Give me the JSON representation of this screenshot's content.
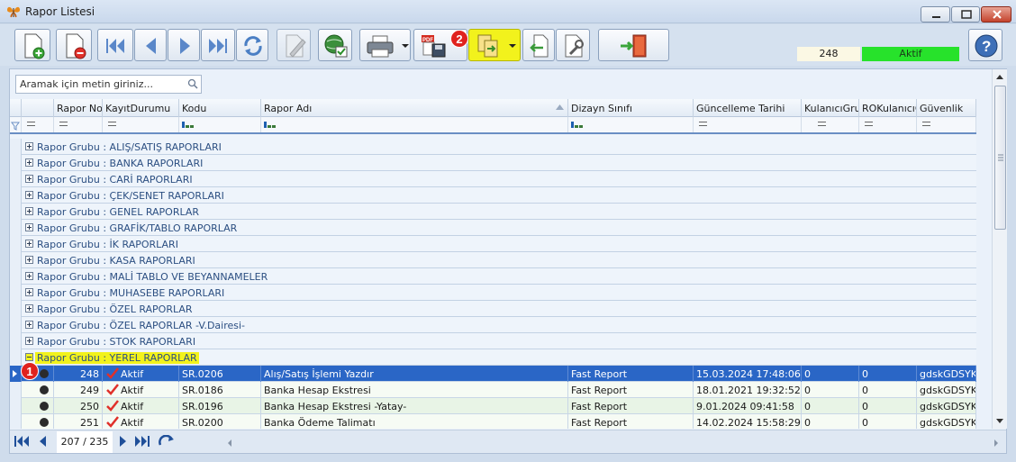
{
  "window": {
    "title": "Rapor Listesi"
  },
  "toolbar": {
    "record_count": "248",
    "status": "Aktif",
    "badge_2": "2"
  },
  "search": {
    "placeholder": "Aramak için metin giriniz..."
  },
  "columns": [
    "Rapor No",
    "KayıtDurumu",
    "Kodu",
    "Rapor Adı",
    "Dizayn Sınıfı",
    "Güncelleme Tarihi",
    "KulanıcıGrup",
    "ROKulanıcıGr",
    "Güvenlik"
  ],
  "groups": [
    "Rapor Grubu : ALIŞ/SATIŞ RAPORLARI",
    "Rapor Grubu : BANKA RAPORLARI",
    "Rapor Grubu : CARİ RAPORLARI",
    "Rapor Grubu : ÇEK/SENET RAPORLARI",
    "Rapor Grubu : GENEL RAPORLAR",
    "Rapor Grubu : GRAFİK/TABLO RAPORLAR",
    "Rapor Grubu : İK RAPORLARI",
    "Rapor Grubu : KASA RAPORLARI",
    "Rapor Grubu : MALİ TABLO VE BEYANNAMELER",
    "Rapor Grubu : MUHASEBE RAPORLARI",
    "Rapor Grubu : ÖZEL RAPORLAR",
    "Rapor Grubu : ÖZEL RAPORLAR -V.Dairesi-",
    "Rapor Grubu : STOK RAPORLARI"
  ],
  "expanded_group": "Rapor Grubu : YEREL RAPORLAR",
  "rows": [
    {
      "no": "248",
      "status": "Aktif",
      "code": "SR.0206",
      "name": "Alış/Satış İşlemi Yazdır",
      "design": "Fast Report",
      "date": "15.03.2024 17:48:06",
      "grp": "0",
      "rogrp": "0",
      "sec": "gdskGDSYK"
    },
    {
      "no": "249",
      "status": "Aktif",
      "code": "SR.0186",
      "name": "Banka Hesap Ekstresi",
      "design": "Fast Report",
      "date": "18.01.2021 19:32:52",
      "grp": "0",
      "rogrp": "0",
      "sec": "gdskGDSYK"
    },
    {
      "no": "250",
      "status": "Aktif",
      "code": "SR.0196",
      "name": "Banka Hesap Ekstresi -Yatay-",
      "design": "Fast Report",
      "date": "9.01.2024 09:41:58",
      "grp": "0",
      "rogrp": "0",
      "sec": "gdskGDSYK"
    },
    {
      "no": "251",
      "status": "Aktif",
      "code": "SR.0200",
      "name": "Banka Ödeme Talimatı",
      "design": "Fast Report",
      "date": "14.02.2024 15:58:29",
      "grp": "0",
      "rogrp": "0",
      "sec": "gdskGDSYK"
    }
  ],
  "annotation": {
    "badge_1": "1"
  },
  "navigator": {
    "page": "207 / 235"
  },
  "colors": {
    "selected_row": "#2a66c6",
    "highlight": "#f2f21c",
    "status_green": "#27e22b",
    "badge_red": "#e0221e"
  }
}
